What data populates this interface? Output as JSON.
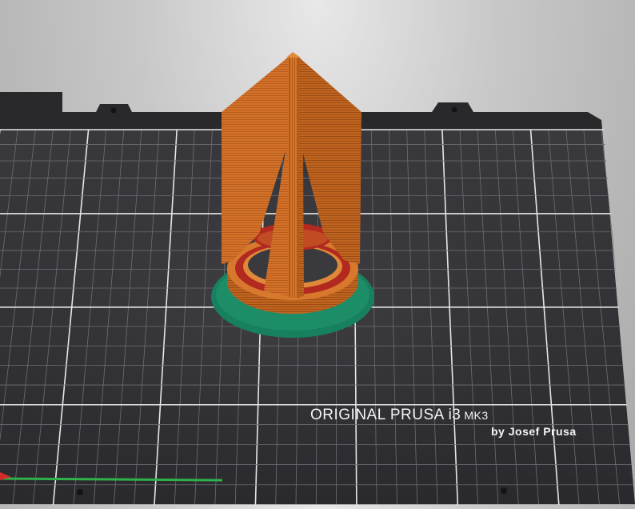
{
  "scene": {
    "printer_label": "ORIGINAL PRUSA i3",
    "printer_model": "MK3",
    "maker_label": "by Josef Prusa",
    "colors": {
      "background": "#c4c4c4",
      "bed": "#2f2f33",
      "grid_minor": "#6d6d72",
      "grid_major": "#e6e6e6",
      "perimeter_orange": "#d8742a",
      "perimeter_shadow": "#a9551a",
      "inner_red": "#b22a1f",
      "skirt_green": "#17805e",
      "axis_green": "#2fb24a",
      "axis_red": "#d42a2a"
    },
    "icons": [
      "bed-mount-notch",
      "bed-screw-hole"
    ]
  }
}
